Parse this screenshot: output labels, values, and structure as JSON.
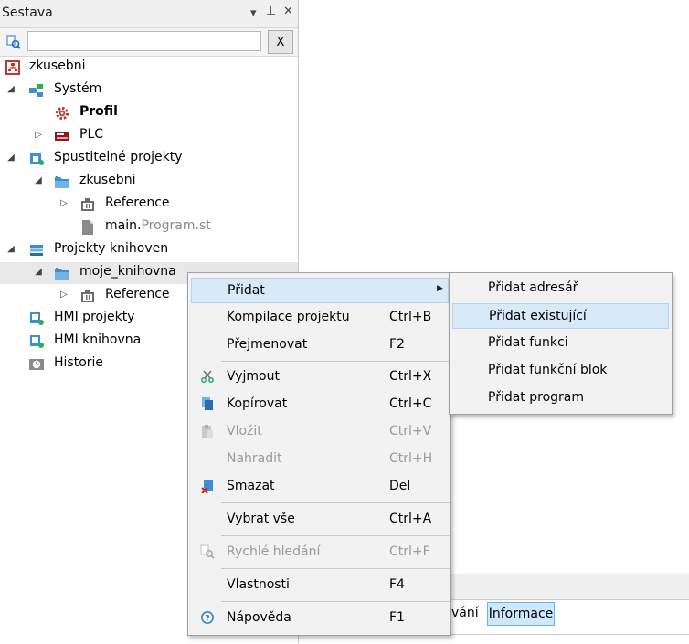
{
  "panel": {
    "title": "Sestava",
    "controls": {
      "dropdown": "▾",
      "pin": "⊥",
      "close": "✕"
    },
    "search": {
      "value": "",
      "clear_label": "X"
    }
  },
  "tree": {
    "root": "zkusebni",
    "system": "Systém",
    "profil": "Profil",
    "plc": "PLC",
    "spustitelne": "Spustitelné projekty",
    "zkusebni_proj": "zkusebni",
    "reference1": "Reference",
    "main_prefix": "main.",
    "main_suffix": "Program.st",
    "projekty_knihoven": "Projekty knihoven",
    "moje_knihovna": "moje_knihovna",
    "reference2": "Reference",
    "hmi_projekty": "HMI projekty",
    "hmi_knihovna": "HMI knihovna",
    "historie": "Historie"
  },
  "bottom": {
    "tab_partial": "vání",
    "tab_info": "Informace"
  },
  "context_menu": {
    "pridat": "Přidat",
    "kompilace": {
      "label": "Kompilace projektu",
      "key": "Ctrl+B"
    },
    "prejmenovat": {
      "label": "Přejmenovat",
      "key": "F2"
    },
    "vyjmout": {
      "label": "Vyjmout",
      "key": "Ctrl+X"
    },
    "kopirovat": {
      "label": "Kopírovat",
      "key": "Ctrl+C"
    },
    "vlozit": {
      "label": "Vložit",
      "key": "Ctrl+V"
    },
    "nahradit": {
      "label": "Nahradit",
      "key": "Ctrl+H"
    },
    "smazat": {
      "label": "Smazat",
      "key": "Del"
    },
    "vybrat": {
      "label": "Vybrat vše",
      "key": "Ctrl+A"
    },
    "hledani": {
      "label": "Rychlé hledání",
      "key": "Ctrl+F"
    },
    "vlastnosti": {
      "label": "Vlastnosti",
      "key": "F4"
    },
    "napoveda": {
      "label": "Nápověda",
      "key": "F1"
    }
  },
  "submenu": {
    "adresar": "Přidat adresář",
    "existujici": "Přidat existující",
    "funkci": "Přidat funkci",
    "funkcni_blok": "Přidat funkční blok",
    "program": "Přidat program"
  },
  "colors": {
    "highlight": "#d8e9f8",
    "selected_row": "#e8e8e8",
    "info_tab": "#cde8ff",
    "folder": "#3c8fd6",
    "red_icon": "#c0392b"
  }
}
